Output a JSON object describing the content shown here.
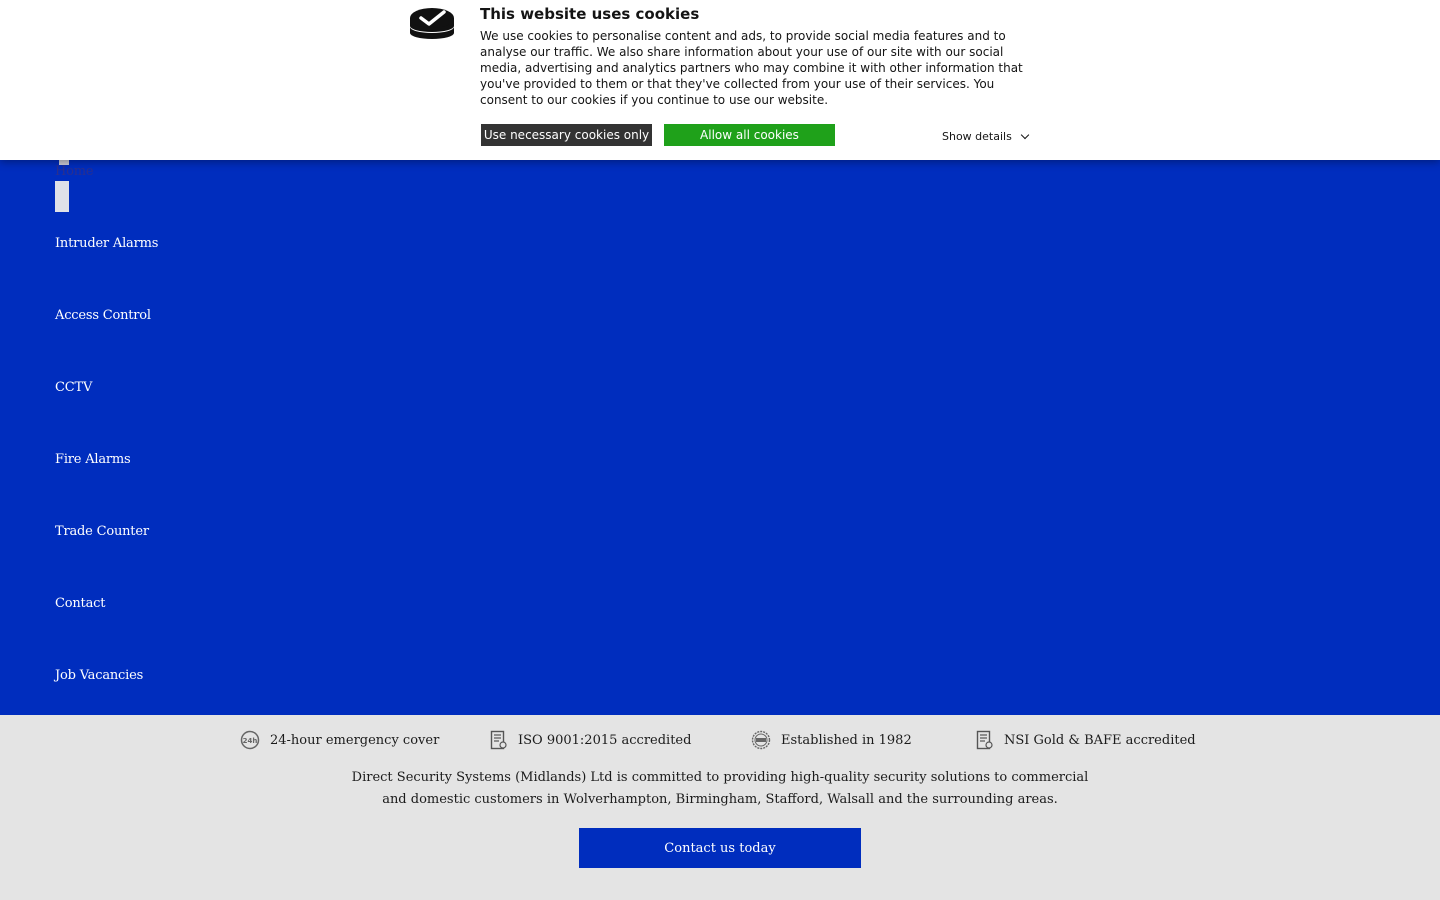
{
  "cookie_banner": {
    "title": "This website uses cookies",
    "body": "We use cookies to personalise content and ads, to provide social media features and to analyse our traffic. We also share information about your use of our site with our social media, advertising and analytics partners who may combine it with other information that you've provided to them or that they've collected from your use of their services. You consent to our cookies if you continue to use our website.",
    "necessary_label": "Use necessary cookies only",
    "allow_label": "Allow all cookies",
    "details_label": "Show details",
    "icon": "cookie-check-icon"
  },
  "nav": {
    "items": [
      {
        "label": "Home"
      },
      {
        "label": "Intruder Alarms"
      },
      {
        "label": "Access Control"
      },
      {
        "label": "CCTV"
      },
      {
        "label": "Fire Alarms"
      },
      {
        "label": "Trade Counter"
      },
      {
        "label": "Contact"
      },
      {
        "label": "Job Vacancies"
      }
    ]
  },
  "footer": {
    "features": [
      {
        "label": "24-hour emergency cover",
        "icon": "24h-icon"
      },
      {
        "label": "ISO 9001:2015 accredited",
        "icon": "certificate-icon"
      },
      {
        "label": "Established in 1982",
        "icon": "seal-1982-icon"
      },
      {
        "label": "NSI Gold & BAFE accredited",
        "icon": "certificate-icon"
      }
    ],
    "statement": "Direct Security Systems (Midlands) Ltd is committed to providing high-quality security solutions to commercial and domestic customers in Wolverhampton, Birmingham, Stafford, Walsall and the surrounding areas.",
    "cta_label": "Contact us today"
  },
  "colors": {
    "brand_blue": "#002dbe",
    "allow_green": "#1fa11a",
    "necessary_dark": "#333333",
    "footer_grey": "#e4e4e4"
  }
}
